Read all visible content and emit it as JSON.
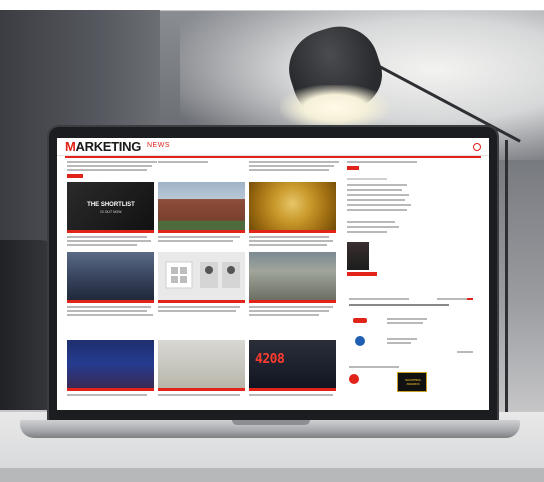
{
  "site": {
    "logo_main": "ARKETING",
    "logo_initial": "M",
    "logo_suffix": "NEWS"
  },
  "feature": {
    "shortlist_title": "THE SHORTLIST",
    "shortlist_sub": "IS OUT NOW"
  },
  "ticker": {
    "led_value": "4208"
  },
  "sidebar": {
    "badge_text": "SHOPPING AWARDS"
  },
  "colors": {
    "brand_red": "#e2231a",
    "bezel": "#1c1d20"
  }
}
